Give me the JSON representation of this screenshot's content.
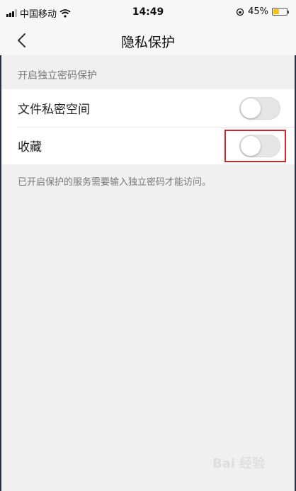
{
  "status_bar": {
    "carrier": "中国移动",
    "time": "14:49",
    "battery_percent": "45%",
    "battery_level": 0.45,
    "battery_color": "#f2c40f"
  },
  "nav": {
    "title": "隐私保护",
    "back_icon": "chevron-left-icon"
  },
  "section": {
    "label": "开启独立密码保护"
  },
  "rows": [
    {
      "label": "文件私密空间",
      "toggle_on": false
    },
    {
      "label": "收藏",
      "toggle_on": false
    }
  ],
  "footer_note": "已开启保护的服务需要输入独立密码才能访问。",
  "highlight_color": "#d0262c",
  "watermark": "Bai 经验"
}
